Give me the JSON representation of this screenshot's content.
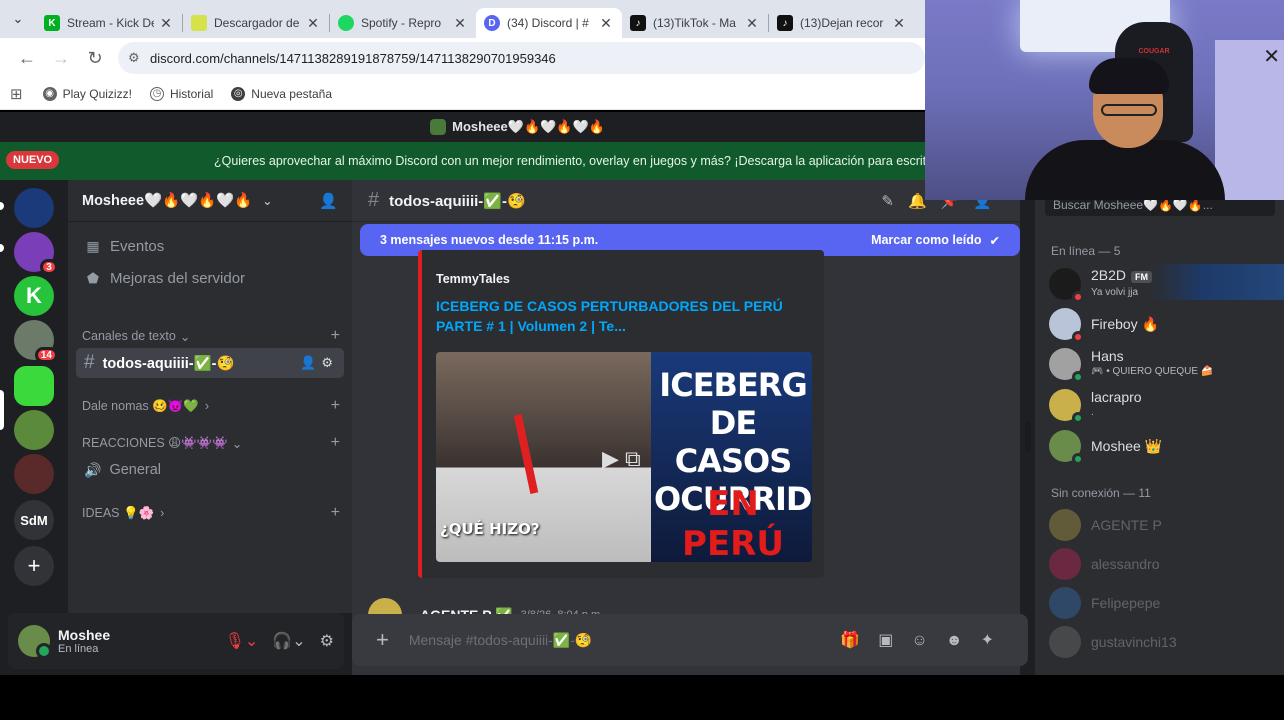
{
  "browser": {
    "tabs": [
      {
        "title": "Stream - Kick De",
        "fav_color": "#00b020",
        "fav_glyph": "K"
      },
      {
        "title": "Descargador de",
        "fav_color": "#d6e24a",
        "fav_glyph": ""
      },
      {
        "title": "Spotify - Repro",
        "fav_color": "#1ed760",
        "fav_glyph": ""
      },
      {
        "title": "(34) Discord | #",
        "fav_color": "#5865f2",
        "fav_glyph": "D"
      },
      {
        "title": "(13)TikTok - Ma",
        "fav_color": "#111111",
        "fav_glyph": "♪"
      },
      {
        "title": "(13)Dejan recor",
        "fav_color": "#111111",
        "fav_glyph": "♪"
      }
    ],
    "url": "discord.com/channels/1471138289191878759/1471138290701959346",
    "bookmarks": [
      "Play Quizizz!",
      "Historial",
      "Nueva pestaña"
    ]
  },
  "discord": {
    "window_title": "Mosheee🤍🔥🤍🔥🤍🔥",
    "notice_badge": "NUEVO",
    "notice_text": "¿Quieres aprovechar al máximo Discord con un mejor rendimiento, overlay en juegos y más? ¡Descarga la aplicación para escrit",
    "servers": [
      {
        "label": "",
        "color": "#1b3a7a",
        "badge": ""
      },
      {
        "label": "",
        "color": "#7a3fb8",
        "badge": "3"
      },
      {
        "label": "K",
        "color": "#27c33a",
        "badge": ""
      },
      {
        "label": "",
        "color": "#6c7a6a",
        "badge": "14"
      },
      {
        "label": "",
        "color": "#3bd93b",
        "badge": ""
      },
      {
        "label": "",
        "color": "#5a8a3a",
        "badge": ""
      },
      {
        "label": "",
        "color": "#5a2a2a",
        "badge": ""
      },
      {
        "label": "SdM",
        "color": "#313338",
        "badge": ""
      },
      {
        "label": "+",
        "color": "#313338",
        "badge": ""
      }
    ],
    "server_name": "Mosheee🤍🔥🤍🔥🤍🔥",
    "nav": [
      {
        "label": "Eventos",
        "icon": "calendar-icon"
      },
      {
        "label": "Mejoras del servidor",
        "icon": "boost-icon"
      }
    ],
    "categories": {
      "text": "Canales de texto",
      "dale": "Dale nomas 🥴👿💚",
      "reacciones": "REACCIONES 😩👾👾👾",
      "ideas": "IDEAS 💡🌸"
    },
    "channels": {
      "selected": "todos-aquiiii-✅-🧐",
      "general": "General"
    },
    "user": {
      "name": "Moshee",
      "status": "En línea"
    },
    "chat": {
      "channel_name": "todos-aquiiii-✅-🧐",
      "new_messages": "3 mensajes nuevos desde 11:15 p.m.",
      "mark_read": "Marcar como leído",
      "embed_provider": "TemmyTales",
      "embed_title": "ICEBERG DE CASOS PERTURBADORES DEL PERÚ PARTE # 1 | Volumen 2 | Te...",
      "thumb_big": "ICEBERG DE CASOS OCURRIDOS",
      "thumb_red": "EN PERÚ",
      "thumb_small": "¿QUÉ HIZO?",
      "next_author": "AGENTE P ✅",
      "next_time": "3/8/26, 8:04 p.m.",
      "composer_placeholder": "Mensaje #todos-aquiiii-✅-🧐"
    },
    "members": {
      "search_placeholder": "Buscar Mosheee🤍🔥🤍🔥...",
      "online_header": "En línea — 5",
      "offline_header": "Sin conexión — 11",
      "online": [
        {
          "name": "2B2D",
          "sub": "Ya volvi jja",
          "tag": "FM",
          "color": "#1b1b1b",
          "status": "#f23f43"
        },
        {
          "name": "Fireboy 🔥",
          "sub": "",
          "tag": "",
          "color": "#b9c4d9",
          "status": "#f23f43"
        },
        {
          "name": "Hans",
          "sub": "🎮 • QUIERO QUEQUE 🍰",
          "tag": "",
          "color": "#a1a1a1",
          "status": "#23a55a"
        },
        {
          "name": "lacrapro",
          "sub": ".",
          "tag": "",
          "color": "#c9b04a",
          "status": "#23a55a"
        },
        {
          "name": "Moshee 👑",
          "sub": "",
          "tag": "",
          "color": "#6a8c4a",
          "status": "#23a55a"
        }
      ],
      "offline": [
        {
          "name": "AGENTE P",
          "color": "#c9b04a"
        },
        {
          "name": "alessandro",
          "color": "#e0245e"
        },
        {
          "name": "Felipepepe",
          "color": "#3a7ad0"
        },
        {
          "name": "gustavinchi13",
          "color": "#7a7a7a"
        }
      ]
    }
  },
  "webcam": {
    "chair_label": "COUGAR"
  }
}
